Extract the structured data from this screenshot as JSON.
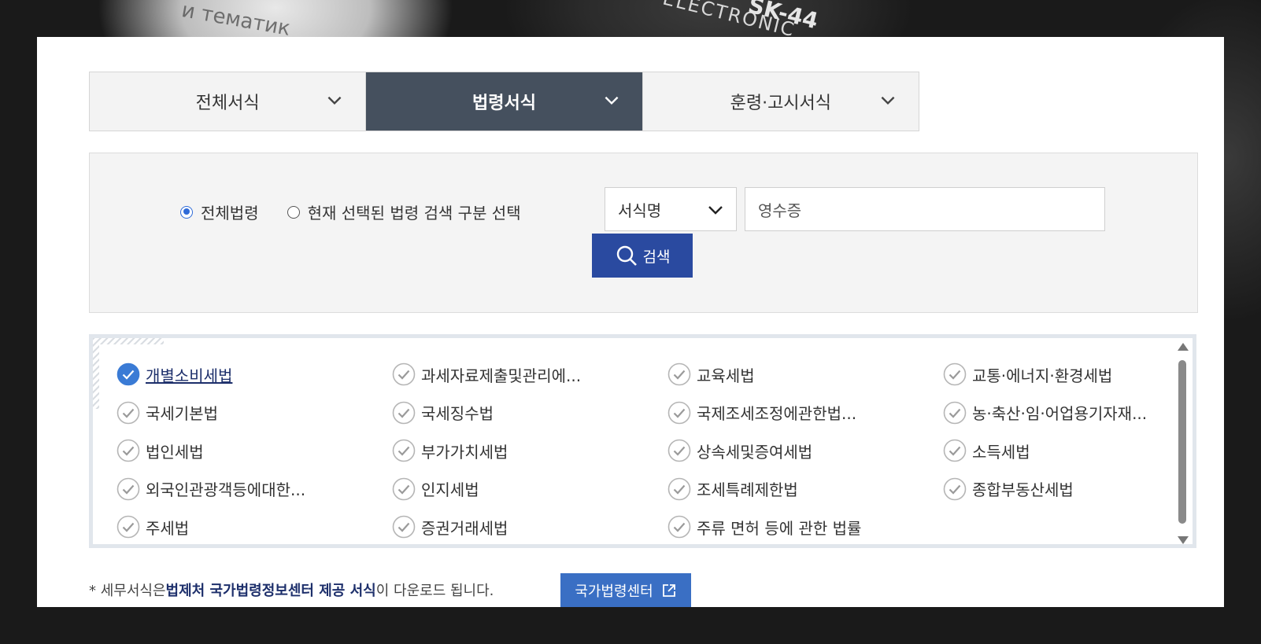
{
  "background": {
    "text_a": "и тематик",
    "text_b": "ELECTRONIC",
    "text_c": "SK-44"
  },
  "tabs": [
    {
      "label": "전체서식",
      "active": false
    },
    {
      "label": "법령서식",
      "active": true
    },
    {
      "label": "훈령·고시서식",
      "active": false
    }
  ],
  "search": {
    "radio_all": "전체법령",
    "radio_current": "현재 선택된 법령 검색 구분 선택",
    "field_select": "서식명",
    "query": "영수증",
    "button": "검색"
  },
  "laws": [
    "개별소비세법",
    "과세자료제출및관리에...",
    "교육세법",
    "교통·에너지·환경세법",
    "국세기본법",
    "국세징수법",
    "국제조세조정에관한법...",
    "농·축산·임·어업용기자재...",
    "법인세법",
    "부가가치세법",
    "상속세및증여세법",
    "소득세법",
    "외국인관광객등에대한...",
    "인지세법",
    "조세특례제한법",
    "종합부동산세법",
    "주세법",
    "증권거래세법",
    "주류 면허 등에 관한 법률"
  ],
  "selected_index": 0,
  "note": {
    "prefix": "* 세무서식은 ",
    "bold": "법제처 국가법령정보센터 제공 서식",
    "suffix": "이 다운로드 됩니다.",
    "button": "국가법령센터"
  },
  "colors": {
    "active_tab": "#45505e",
    "search_button": "#2a4aa0",
    "link_button": "#3a6fc4",
    "check_selected": "#3a7bd5"
  }
}
